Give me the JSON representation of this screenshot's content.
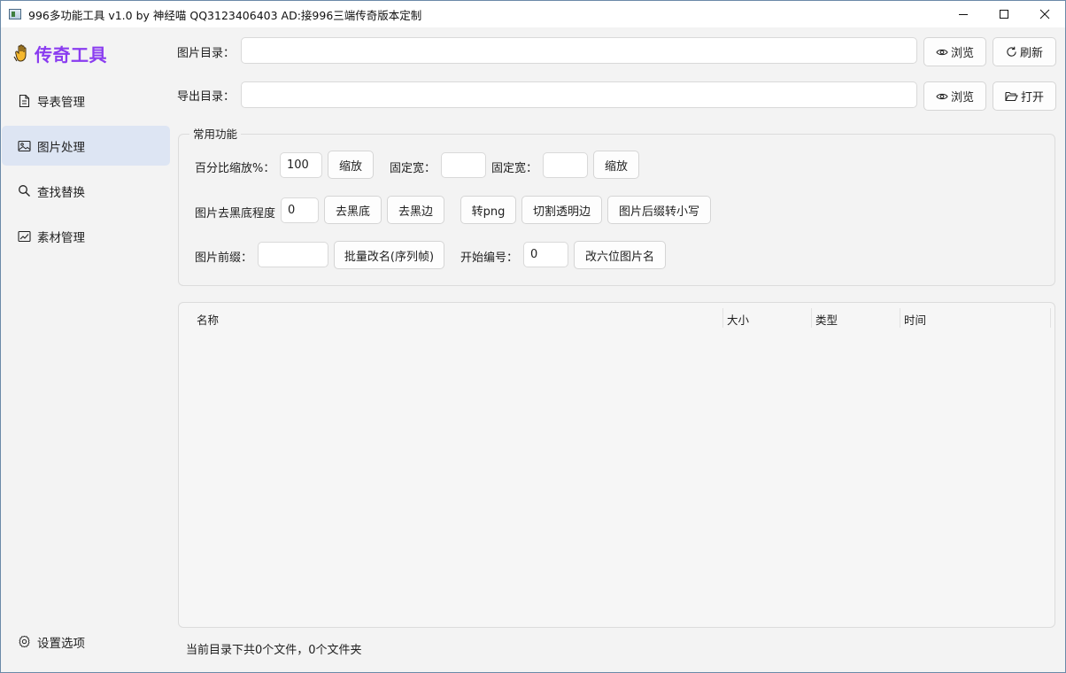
{
  "window": {
    "title": "996多功能工具 v1.0 by 神经喵 QQ3123406403 AD:接996三端传奇版本定制"
  },
  "sidebar": {
    "brand": "传奇工具",
    "items": [
      {
        "label": "导表管理",
        "icon": "document-icon"
      },
      {
        "label": "图片处理",
        "icon": "image-icon",
        "active": true
      },
      {
        "label": "查找替换",
        "icon": "search-icon"
      },
      {
        "label": "素材管理",
        "icon": "chart-icon"
      }
    ],
    "settings": {
      "label": "设置选项",
      "icon": "gear-icon"
    }
  },
  "paths": {
    "image_dir_label": "图片目录：",
    "image_dir_value": "",
    "export_dir_label": "导出目录：",
    "export_dir_value": "",
    "browse_label": "浏览",
    "refresh_label": "刷新",
    "open_label": "打开"
  },
  "common": {
    "title": "常用功能",
    "row1": {
      "percent_label": "百分比缩放%：",
      "percent_value": "100",
      "scale_button": "缩放",
      "fixed_width_label_1": "固定宽：",
      "fixed_width_value_1": "",
      "fixed_width_label_2": "固定宽：",
      "fixed_width_value_2": "",
      "scale_button_2": "缩放"
    },
    "row2": {
      "black_level_label": "图片去黑底程度",
      "black_level_value": "0",
      "remove_black_bg": "去黑底",
      "remove_black_edge": "去黑边",
      "to_png": "转png",
      "cut_transparent": "切割透明边",
      "suffix_lower": "图片后缀转小写"
    },
    "row3": {
      "prefix_label": "图片前缀：",
      "prefix_value": "",
      "batch_rename": "批量改名(序列帧)",
      "start_num_label": "开始编号：",
      "start_num_value": "0",
      "six_digit_rename": "改六位图片名"
    }
  },
  "table": {
    "columns": [
      "名称",
      "大小",
      "类型",
      "时间"
    ],
    "rows": []
  },
  "status": {
    "text": "当前目录下共0个文件，0个文件夹"
  },
  "colors": {
    "brand": "#8a3cf0",
    "active_nav": "#dde5f3",
    "background": "#f3f3f3"
  }
}
